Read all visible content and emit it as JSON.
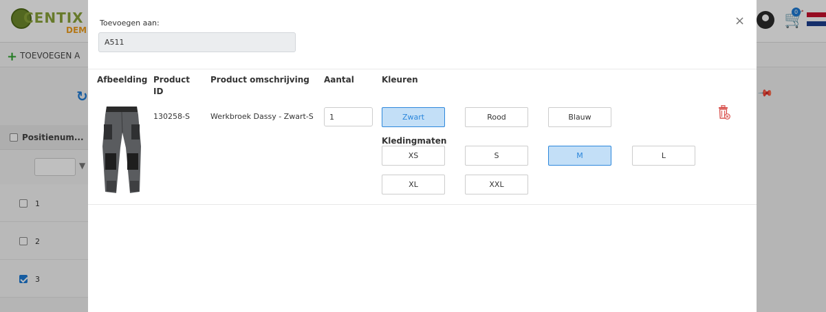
{
  "background": {
    "logo_text": "CENTIX",
    "logo_sub": "DEM",
    "toolbar_add_label": "TOEVOEGEN A",
    "column_header": "Positienum...",
    "rows": [
      {
        "label": "1",
        "checked": false
      },
      {
        "label": "2",
        "checked": false
      },
      {
        "label": "3",
        "checked": true
      }
    ],
    "cart_count": "0",
    "icons": [
      "refresh-icon",
      "filter-icon",
      "avatar-icon",
      "cart-icon",
      "flag-nl-icon",
      "pin-icon"
    ]
  },
  "modal": {
    "close_symbol": "×",
    "add_to_label": "Toevoegen aan:",
    "add_to_value": "A511",
    "headers": {
      "image": "Afbeelding",
      "product_id": "Product ID",
      "description": "Product omschrijving",
      "quantity": "Aantal",
      "colors": "Kleuren"
    },
    "product": {
      "id": "130258-S",
      "description": "Werkbroek Dassy - Zwart-S",
      "quantity": "1"
    },
    "colors": [
      {
        "label": "Zwart",
        "selected": true
      },
      {
        "label": "Rood",
        "selected": false
      },
      {
        "label": "Blauw",
        "selected": false
      }
    ],
    "sizes_label": "Kledingmaten",
    "sizes": [
      {
        "label": "XS",
        "selected": false
      },
      {
        "label": "S",
        "selected": false
      },
      {
        "label": "M",
        "selected": true
      },
      {
        "label": "L",
        "selected": false
      },
      {
        "label": "XL",
        "selected": false
      },
      {
        "label": "XXL",
        "selected": false
      }
    ],
    "accent_color": "#2b86db",
    "selected_bg": "#c3dff7",
    "delete_color": "#d9534f"
  }
}
